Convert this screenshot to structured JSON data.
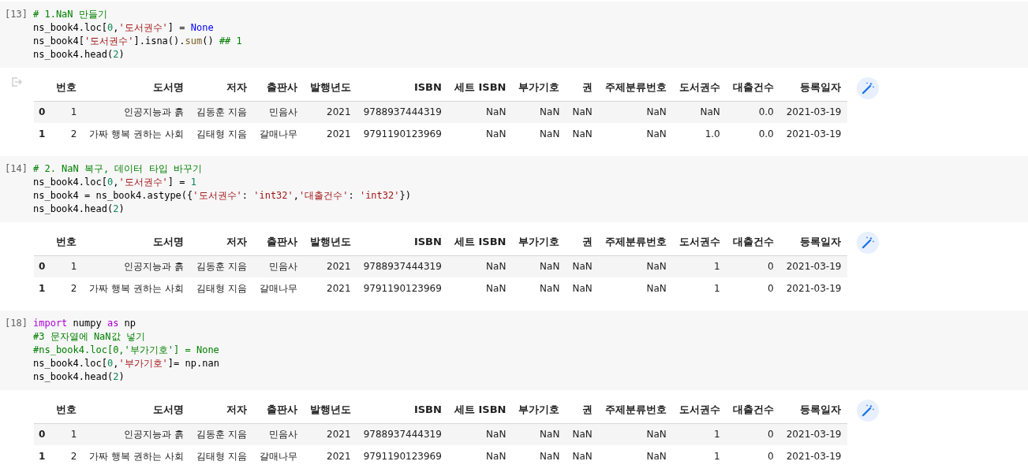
{
  "cells": [
    {
      "prompt": "[13]",
      "code": [
        [
          {
            "kind": "comment",
            "text": "# 1.NaN 만들기"
          }
        ],
        [
          {
            "kind": "plain",
            "text": "ns_book4.loc["
          },
          {
            "kind": "number",
            "text": "0"
          },
          {
            "kind": "plain",
            "text": ","
          },
          {
            "kind": "string",
            "text": "'도서권수'"
          },
          {
            "kind": "plain",
            "text": "] = "
          },
          {
            "kind": "constant",
            "text": "None"
          }
        ],
        [
          {
            "kind": "plain",
            "text": "ns_book4["
          },
          {
            "kind": "string",
            "text": "'도서권수'"
          },
          {
            "kind": "plain",
            "text": "].isna()."
          },
          {
            "kind": "builtin",
            "text": "sum"
          },
          {
            "kind": "plain",
            "text": "() "
          },
          {
            "kind": "comment",
            "text": "## 1"
          }
        ],
        [
          {
            "kind": "plain",
            "text": "ns_book4.head("
          },
          {
            "kind": "number",
            "text": "2"
          },
          {
            "kind": "plain",
            "text": ")"
          }
        ]
      ],
      "output": {
        "output_marker": true,
        "columns": [
          "번호",
          "도서명",
          "저자",
          "출판사",
          "발행년도",
          "ISBN",
          "세트 ISBN",
          "부가기호",
          "권",
          "주제분류번호",
          "도서권수",
          "대출건수",
          "등록일자"
        ],
        "rows": [
          {
            "index": "0",
            "cells": [
              "1",
              "인공지능과 흙",
              "김동훈 지음",
              "민음사",
              "2021",
              "9788937444319",
              "NaN",
              "NaN",
              "NaN",
              "NaN",
              "NaN",
              "0.0",
              "2021-03-19"
            ]
          },
          {
            "index": "1",
            "cells": [
              "2",
              "가짜 행복 권하는 사회",
              "김태형 지음",
              "갈매나무",
              "2021",
              "9791190123969",
              "NaN",
              "NaN",
              "NaN",
              "NaN",
              "1.0",
              "0.0",
              "2021-03-19"
            ]
          }
        ]
      }
    },
    {
      "prompt": "[14]",
      "code": [
        [
          {
            "kind": "comment",
            "text": "# 2. NaN 복구, 데이터 타입 바꾸기"
          }
        ],
        [
          {
            "kind": "plain",
            "text": "ns_book4.loc["
          },
          {
            "kind": "number",
            "text": "0"
          },
          {
            "kind": "plain",
            "text": ","
          },
          {
            "kind": "string",
            "text": "'도서권수'"
          },
          {
            "kind": "plain",
            "text": "] = "
          },
          {
            "kind": "number",
            "text": "1"
          }
        ],
        [
          {
            "kind": "plain",
            "text": "ns_book4 = ns_book4.astype({"
          },
          {
            "kind": "string",
            "text": "'도서권수'"
          },
          {
            "kind": "plain",
            "text": ": "
          },
          {
            "kind": "string",
            "text": "'int32'"
          },
          {
            "kind": "plain",
            "text": ","
          },
          {
            "kind": "string",
            "text": "'대출건수'"
          },
          {
            "kind": "plain",
            "text": ": "
          },
          {
            "kind": "string",
            "text": "'int32'"
          },
          {
            "kind": "plain",
            "text": "})"
          }
        ],
        [
          {
            "kind": "plain",
            "text": "ns_book4.head("
          },
          {
            "kind": "number",
            "text": "2"
          },
          {
            "kind": "plain",
            "text": ")"
          }
        ]
      ],
      "output": {
        "output_marker": false,
        "columns": [
          "번호",
          "도서명",
          "저자",
          "출판사",
          "발행년도",
          "ISBN",
          "세트 ISBN",
          "부가기호",
          "권",
          "주제분류번호",
          "도서권수",
          "대출건수",
          "등록일자"
        ],
        "rows": [
          {
            "index": "0",
            "cells": [
              "1",
              "인공지능과 흙",
              "김동훈 지음",
              "민음사",
              "2021",
              "9788937444319",
              "NaN",
              "NaN",
              "NaN",
              "NaN",
              "1",
              "0",
              "2021-03-19"
            ]
          },
          {
            "index": "1",
            "cells": [
              "2",
              "가짜 행복 권하는 사회",
              "김태형 지음",
              "갈매나무",
              "2021",
              "9791190123969",
              "NaN",
              "NaN",
              "NaN",
              "NaN",
              "1",
              "0",
              "2021-03-19"
            ]
          }
        ]
      }
    },
    {
      "prompt": "[18]",
      "code": [
        [
          {
            "kind": "keyword",
            "text": "import"
          },
          {
            "kind": "plain",
            "text": " numpy "
          },
          {
            "kind": "keyword",
            "text": "as"
          },
          {
            "kind": "plain",
            "text": " np"
          }
        ],
        [
          {
            "kind": "comment",
            "text": "#3 문자열에 NaN값 넣기"
          }
        ],
        [
          {
            "kind": "comment",
            "text": "#ns_book4.loc[0,'부가기호'] = None"
          }
        ],
        [
          {
            "kind": "plain",
            "text": "ns_book4.loc["
          },
          {
            "kind": "number",
            "text": "0"
          },
          {
            "kind": "plain",
            "text": ","
          },
          {
            "kind": "string",
            "text": "'부가기호'"
          },
          {
            "kind": "plain",
            "text": "]= np.nan"
          }
        ],
        [
          {
            "kind": "plain",
            "text": "ns_book4.head("
          },
          {
            "kind": "number",
            "text": "2"
          },
          {
            "kind": "plain",
            "text": ")"
          }
        ]
      ],
      "output": {
        "output_marker": false,
        "columns": [
          "번호",
          "도서명",
          "저자",
          "출판사",
          "발행년도",
          "ISBN",
          "세트 ISBN",
          "부가기호",
          "권",
          "주제분류번호",
          "도서권수",
          "대출건수",
          "등록일자"
        ],
        "rows": [
          {
            "index": "0",
            "cells": [
              "1",
              "인공지능과 흙",
              "김동훈 지음",
              "민음사",
              "2021",
              "9788937444319",
              "NaN",
              "NaN",
              "NaN",
              "NaN",
              "1",
              "0",
              "2021-03-19"
            ]
          },
          {
            "index": "1",
            "cells": [
              "2",
              "가짜 행복 권하는 사회",
              "김태형 지음",
              "갈매나무",
              "2021",
              "9791190123969",
              "NaN",
              "NaN",
              "NaN",
              "NaN",
              "1",
              "0",
              "2021-03-19"
            ]
          }
        ]
      }
    }
  ]
}
